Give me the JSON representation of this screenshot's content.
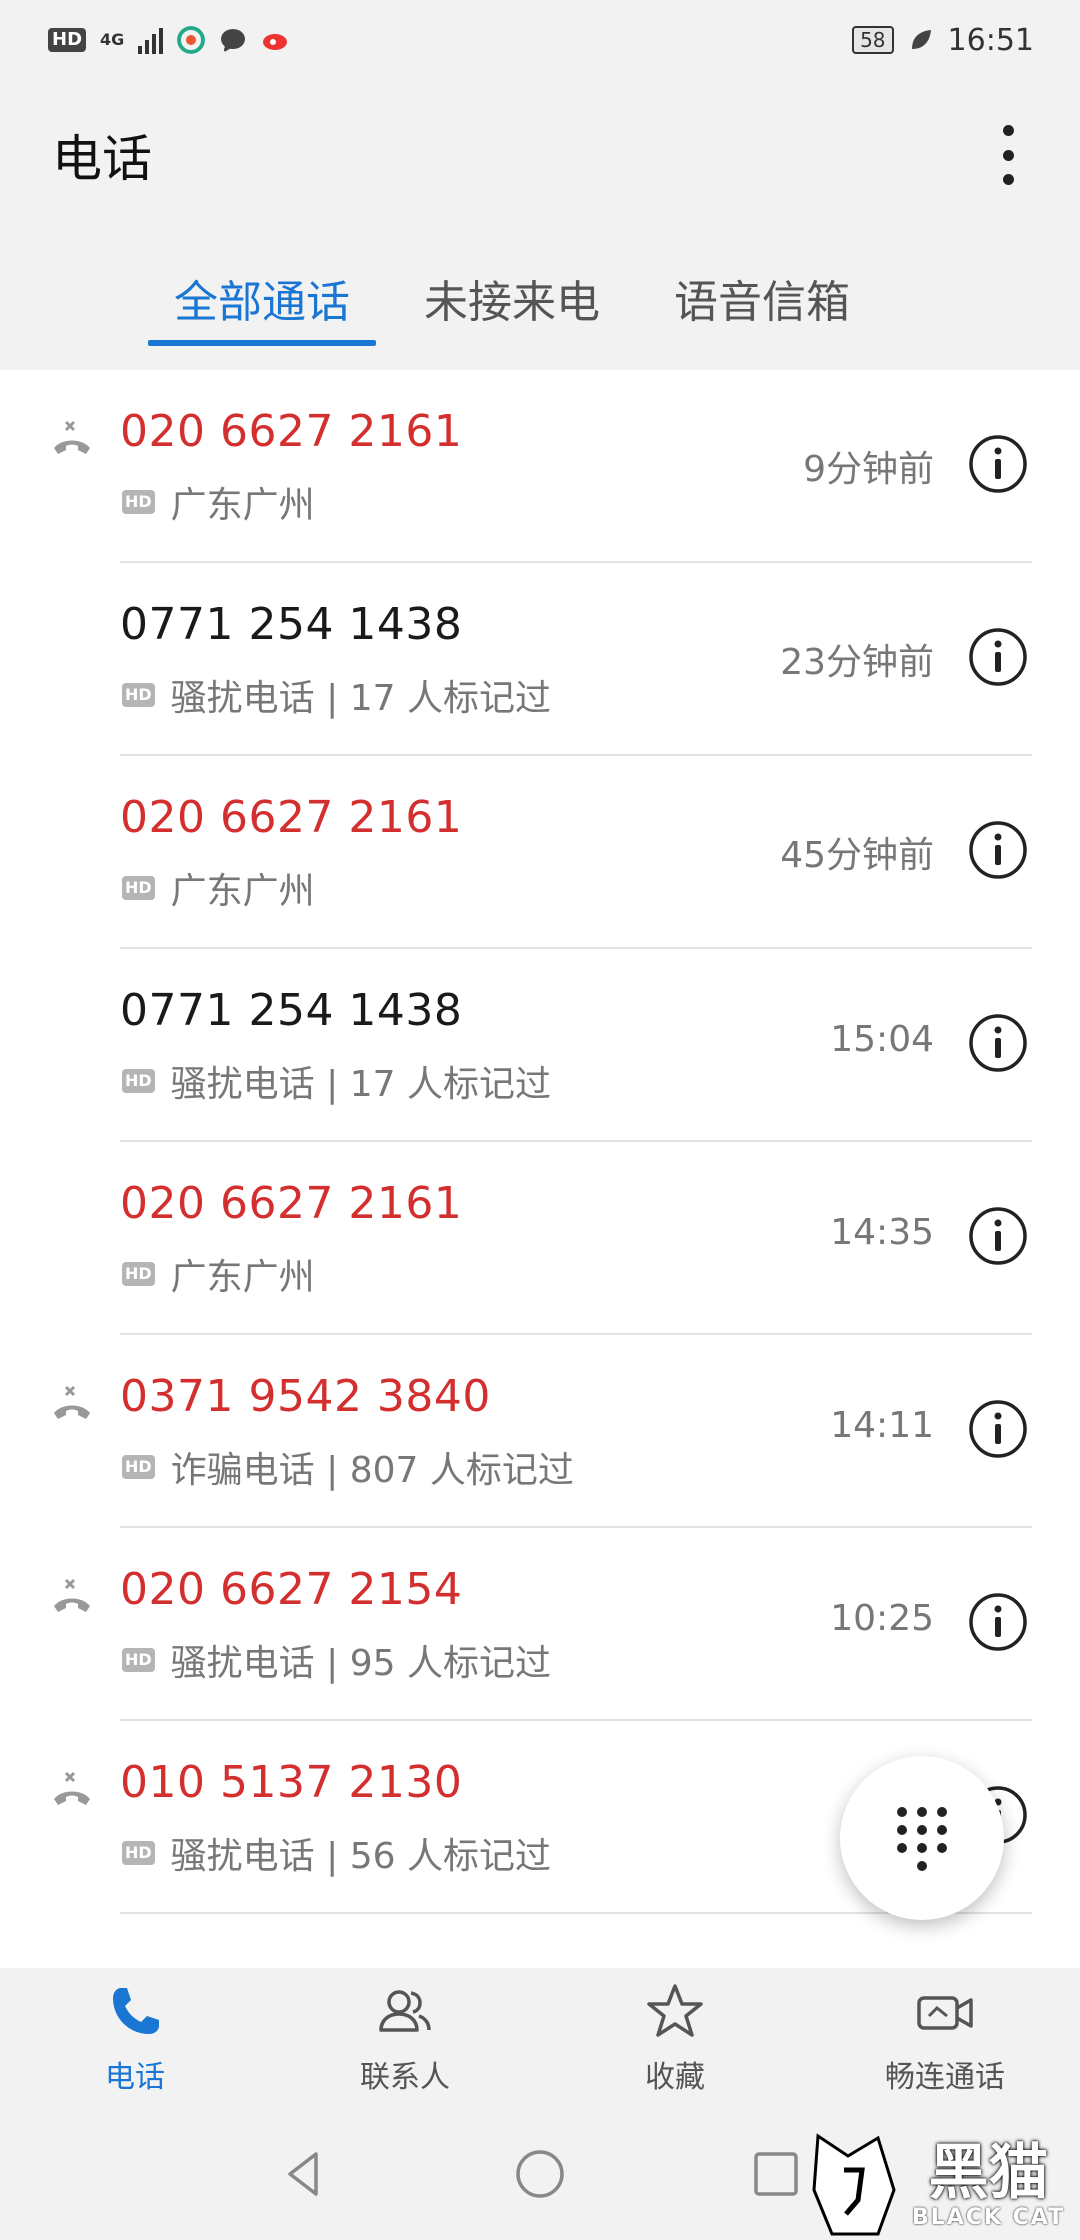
{
  "status_bar": {
    "hd": "HD",
    "network": "4G",
    "battery": "58",
    "time": "16:51"
  },
  "app_bar": {
    "title": "电话"
  },
  "tabs": [
    {
      "label": "全部通话",
      "active": true
    },
    {
      "label": "未接来电",
      "active": false
    },
    {
      "label": "语音信箱",
      "active": false
    }
  ],
  "calls": [
    {
      "number": "020 6627 2161",
      "location": "广东广州",
      "time": "9分钟前",
      "missed": true,
      "red": true
    },
    {
      "number": "0771 254 1438",
      "location": "骚扰电话 | 17 人标记过",
      "time": "23分钟前",
      "missed": false,
      "red": false
    },
    {
      "number": "020 6627 2161",
      "location": "广东广州",
      "time": "45分钟前",
      "missed": false,
      "red": true
    },
    {
      "number": "0771 254 1438",
      "location": "骚扰电话 | 17 人标记过",
      "time": "15:04",
      "missed": false,
      "red": false
    },
    {
      "number": "020 6627 2161",
      "location": "广东广州",
      "time": "14:35",
      "missed": false,
      "red": true
    },
    {
      "number": "0371 9542 3840",
      "location": "诈骗电话 | 807 人标记过",
      "time": "14:11",
      "missed": true,
      "red": true
    },
    {
      "number": "020 6627 2154",
      "location": "骚扰电话 | 95 人标记过",
      "time": "10:25",
      "missed": true,
      "red": true
    },
    {
      "number": "010 5137 2130",
      "location": "骚扰电话 | 56 人标记过",
      "time": "",
      "missed": true,
      "red": true
    }
  ],
  "hd_badge": "HD",
  "bottom_nav": [
    {
      "label": "电话",
      "icon": "phone-icon",
      "active": true
    },
    {
      "label": "联系人",
      "icon": "contacts-icon",
      "active": false
    },
    {
      "label": "收藏",
      "icon": "star-icon",
      "active": false
    },
    {
      "label": "畅连通话",
      "icon": "video-call-icon",
      "active": false
    }
  ],
  "watermark": {
    "cn": "黑猫",
    "en": "BLACK CAT"
  },
  "colors": {
    "accent": "#1976d2",
    "missed_red": "#d32f2f"
  }
}
